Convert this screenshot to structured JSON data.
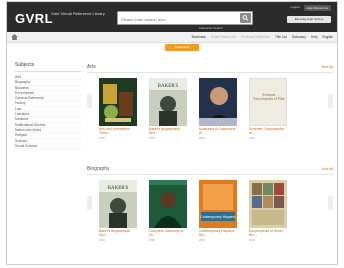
{
  "header": {
    "logo": "GVRL",
    "logo_sub": "Gale Virtual Reference Library",
    "search_placeholder": "Please enter search term",
    "advanced_search": "Advanced Search",
    "top_links": [
      "Logout",
      "Help Resources"
    ],
    "library_button": "Ellensbg High School"
  },
  "toolbar": {
    "items": [
      {
        "label": "Bookmark",
        "dim": false
      },
      {
        "label": "Email Fraction Kit",
        "dim": true
      },
      {
        "label": "Purchase Reference",
        "dim": true
      },
      {
        "label": "Title List",
        "dim": false
      },
      {
        "label": "Dictionary",
        "dim": false
      },
      {
        "label": "Help",
        "dim": false
      },
      {
        "label": "English",
        "dim": false
      }
    ],
    "collection_button": "Collections"
  },
  "sidebar": {
    "title": "Subjects",
    "items": [
      "Arts",
      "Biography",
      "Business",
      "Environment",
      "General Reference",
      "History",
      "Law",
      "Literature",
      "Medicine",
      "Multicultural Studies",
      "Nation and World",
      "Religion",
      "Science",
      "Social Science"
    ]
  },
  "sections": [
    {
      "title": "Arts",
      "view_all": "View All",
      "books": [
        {
          "title": "Arts and Humanities Throu...",
          "year": "2004"
        },
        {
          "title": "Baker's Biographical Dict...",
          "year": "2001"
        },
        {
          "title": "Musicians & Composers of ...",
          "year": "2008"
        },
        {
          "title": "Schirmer Encyclopedia of ...",
          "year": "2007"
        }
      ]
    },
    {
      "title": "Biography",
      "view_all": "View All",
      "books": [
        {
          "title": "Baker's Biographical Dict...",
          "year": "2001"
        },
        {
          "title": "Complete Dictionary of Sc...",
          "year": "2008"
        },
        {
          "title": "Contemporary Hispanic Bio...",
          "year": "2003"
        },
        {
          "title": "Encyclopedia of World Bio...",
          "year": "2004"
        }
      ]
    }
  ],
  "covers": {
    "schirmer_text": "Schirmer Encyclopedia of Film",
    "baker_text": "BAKER'S",
    "hispanic_text": "Contemporary Hispanic"
  }
}
